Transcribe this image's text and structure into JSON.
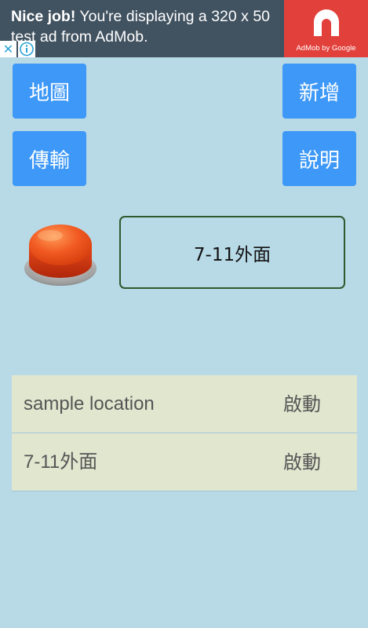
{
  "ad": {
    "headline": "Nice job!",
    "body": " You're displaying a 320 x 50 test ad from AdMob.",
    "brand": "AdMob by Google",
    "close_glyph": "✕"
  },
  "buttons": {
    "map": "地圖",
    "add": "新增",
    "transfer": "傳輸",
    "help": "說明"
  },
  "current_location": "7-11外面",
  "locations": [
    {
      "name": "sample location",
      "action": "啟動"
    },
    {
      "name": "7-11外面",
      "action": "啟動"
    }
  ],
  "colors": {
    "background": "#b8d9e6",
    "button": "#3d98f7",
    "list_bg": "#e1e6cf",
    "ad_bg": "#415260",
    "ad_logo_bg": "#e2403b"
  }
}
